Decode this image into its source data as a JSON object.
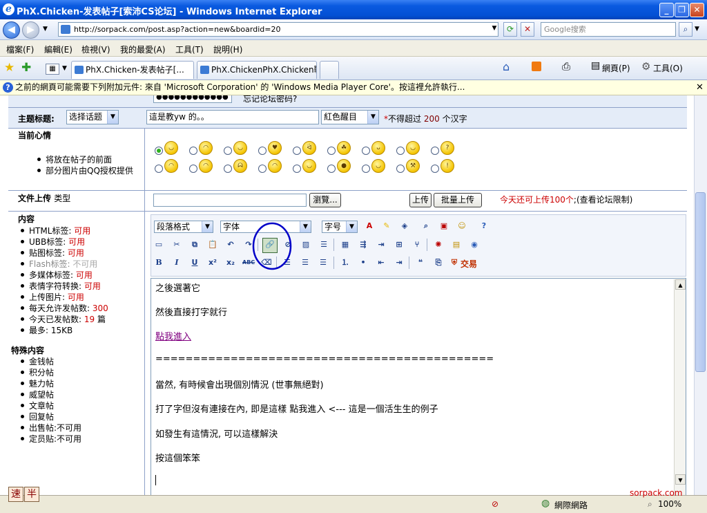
{
  "window": {
    "title": "PhX.Chicken-发表帖子[索沛CS论坛] - Windows Internet Explorer",
    "logo": "e"
  },
  "address": {
    "url": "http://sorpack.com/post.asp?action=new&boardid=20",
    "search_placeholder": "Google搜索"
  },
  "menu": [
    "檔案(F)",
    "編輯(E)",
    "檢視(V)",
    "我的最愛(A)",
    "工具(T)",
    "說明(H)"
  ],
  "tabs": [
    {
      "label": "PhX.Chicken-发表帖子[..."
    },
    {
      "label": "PhX.ChickenPhX.Chicken戰..."
    }
  ],
  "toolbar_right": {
    "page": "網頁(P)",
    "tools": "工具(O)"
  },
  "infobar": {
    "text": "之前的網頁可能需要下列附加元件: 來自 'Microsoft Corporation' 的 'Windows Media Player Core'。按這裡允許執行..."
  },
  "form": {
    "password_value": "●●●●●●●●●●●●",
    "password_hint": "忘记论坛密码?",
    "topic_label": "主题标题:",
    "topic_select": "选择话题",
    "topic_value": "這是教yw 的。。",
    "color_select": "紅色醒目",
    "limit_prefix": "*",
    "limit_text": "不得超过",
    "limit_num": "200",
    "limit_unit": "个汉字",
    "mood_label": "当前心情",
    "mood_bullets": [
      "将放在帖子的前面",
      "部分图片由QQ授权提供"
    ],
    "upload_label": "文件上传",
    "upload_type": "类型",
    "browse_btn": "瀏覽...",
    "upload_btn": "上传",
    "batch_btn": "批量上传",
    "upload_notice": "今天还可上传100个",
    "upload_limit": ";(查看论坛限制)"
  },
  "sidebar": {
    "content_label": "内容",
    "items": [
      {
        "k": "HTML标签:",
        "v": "可用"
      },
      {
        "k": "UBB标签:",
        "v": "可用"
      },
      {
        "k": "贴图标签:",
        "v": "可用"
      },
      {
        "k": "Flash标签:",
        "v": "不可用"
      },
      {
        "k": "多媒体标签:",
        "v": "可用"
      },
      {
        "k": "表情字符转换:",
        "v": "可用"
      },
      {
        "k": "上传图片:",
        "v": "可用"
      },
      {
        "k": "每天允许发帖数:",
        "v": "300"
      },
      {
        "k": "今天已发帖数:",
        "v": "19",
        "u": "篇"
      },
      {
        "k": "最多:",
        "v": "15KB"
      }
    ],
    "special_label": "特殊内容",
    "special": [
      "金钱帖",
      "积分帖",
      "魅力帖",
      "威望帖",
      "文章帖",
      "回复帖",
      "出售帖:不可用",
      "定员贴:不可用"
    ]
  },
  "editor": {
    "para_select": "段落格式",
    "font_select": "字体",
    "size_select": "字号",
    "trade_label": "交易",
    "lines": [
      "之後選著它",
      "然後直接打字就行",
      "點我進入",
      "=============================================",
      "當然, 有時候會出現個別情況 (世事無絕對)",
      "打了字但沒有連接在內, 即是這樣     點我進入      <--- 這是一個活生生的例子",
      "如發生有這情況, 可以這樣解決",
      "按這個笨笨"
    ]
  },
  "status": {
    "zone": "網際網路",
    "zoom": "100%",
    "watermark": "sorpack.com"
  },
  "ime": [
    "速",
    "半"
  ]
}
